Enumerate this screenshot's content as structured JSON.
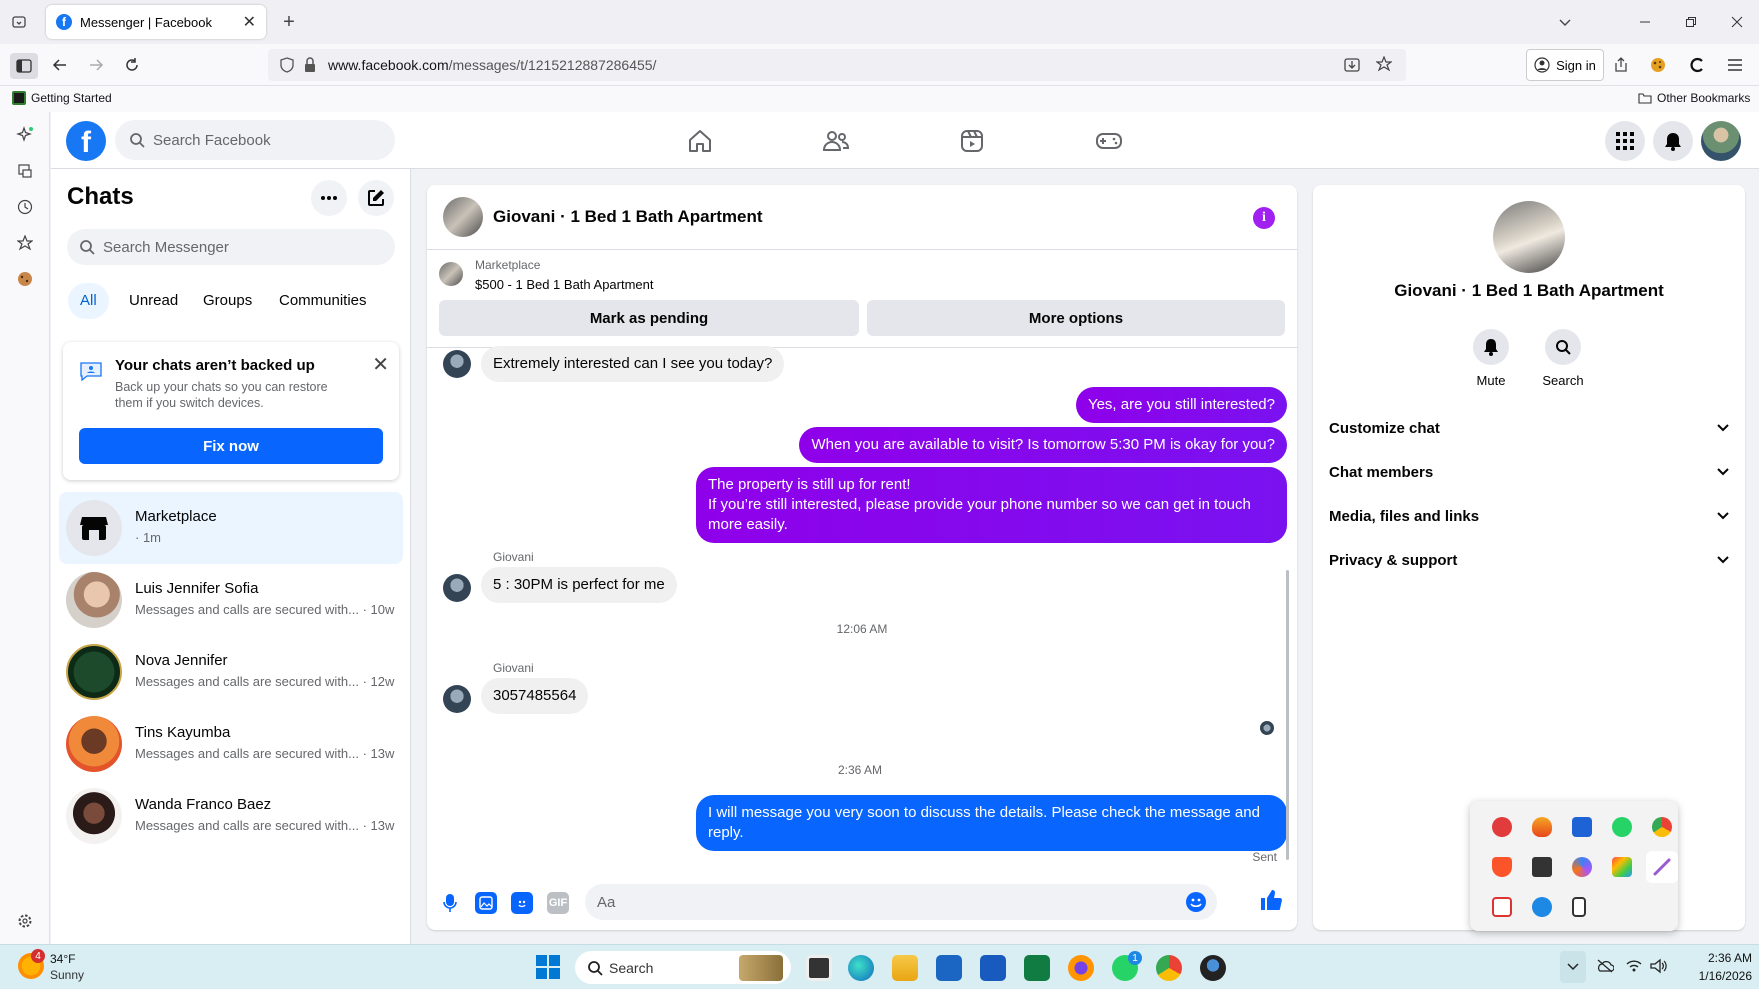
{
  "browser": {
    "tab_title": "Messenger | Facebook",
    "url_domain": "www.facebook.com",
    "url_path": "/messages/t/1215212887286455/",
    "sign_in": "Sign in",
    "bookmark_getting_started": "Getting Started",
    "bookmark_other": "Other Bookmarks"
  },
  "fb": {
    "logo": "f",
    "search_placeholder": "Search Facebook"
  },
  "chats": {
    "title": "Chats",
    "search_placeholder": "Search Messenger",
    "filters": [
      "All",
      "Unread",
      "Groups",
      "Communities"
    ],
    "backup": {
      "title": "Your chats aren’t backed up",
      "desc": "Back up your chats so you can restore them if you switch devices.",
      "button": "Fix now"
    },
    "items": [
      {
        "name": "Marketplace",
        "sub": "· 1m"
      },
      {
        "name": "Luis Jennifer Sofia",
        "sub": "Messages and calls are secured with... · 10w"
      },
      {
        "name": "Nova Jennifer",
        "sub": "Messages and calls are secured with... · 12w"
      },
      {
        "name": "Tins Kayumba",
        "sub": "Messages and calls are secured with... · 13w"
      },
      {
        "name": "Wanda Franco Baez",
        "sub": "Messages and calls are secured with... · 13w"
      }
    ]
  },
  "conversation": {
    "title": "Giovani · 1 Bed 1 Bath Apartment",
    "marketplace_label": "Marketplace",
    "listing": "$500 - 1 Bed 1 Bath Apartment",
    "mark_pending": "Mark as pending",
    "more_options": "More options",
    "messages": [
      {
        "dir": "in",
        "text": "Extremely interested can I see you today?"
      },
      {
        "dir": "out",
        "text": "Yes, are you still interested?"
      },
      {
        "dir": "out",
        "text": "When you are available to visit? Is tomorrow 5:30 PM is okay for you?"
      },
      {
        "dir": "out",
        "text": "The property is still up for rent!\nIf you’re still interested, please provide your phone number so we can get in touch more easily."
      },
      {
        "dir": "in",
        "sender": "Giovani",
        "text": "5 : 30PM is perfect for me"
      },
      {
        "dir": "in",
        "sender": "Giovani",
        "text": "3057485564"
      },
      {
        "dir": "out",
        "text": "I will message you very soon to discuss the details. Please check the message and reply."
      }
    ],
    "timestamps": [
      "12:06 AM",
      "2:36 AM"
    ],
    "sent_label": "Sent",
    "composer_placeholder": "Aa",
    "gif_label": "GIF"
  },
  "info_panel": {
    "name": "Giovani · 1 Bed 1 Bath Apartment",
    "mute": "Mute",
    "search": "Search",
    "sections": [
      "Customize chat",
      "Chat members",
      "Media, files and links",
      "Privacy & support"
    ]
  },
  "taskbar": {
    "weather_temp": "34°F",
    "weather_desc": "Sunny",
    "weather_badge": "4",
    "search_placeholder": "Search",
    "whatsapp_badge": "1",
    "time": "2:36 AM",
    "date": "1/16/2026"
  },
  "colors": {
    "fb_blue": "#1877f2",
    "button_blue": "#0866ff",
    "outgoing_purple": "#8a00e6",
    "info_purple": "#a020f0"
  }
}
